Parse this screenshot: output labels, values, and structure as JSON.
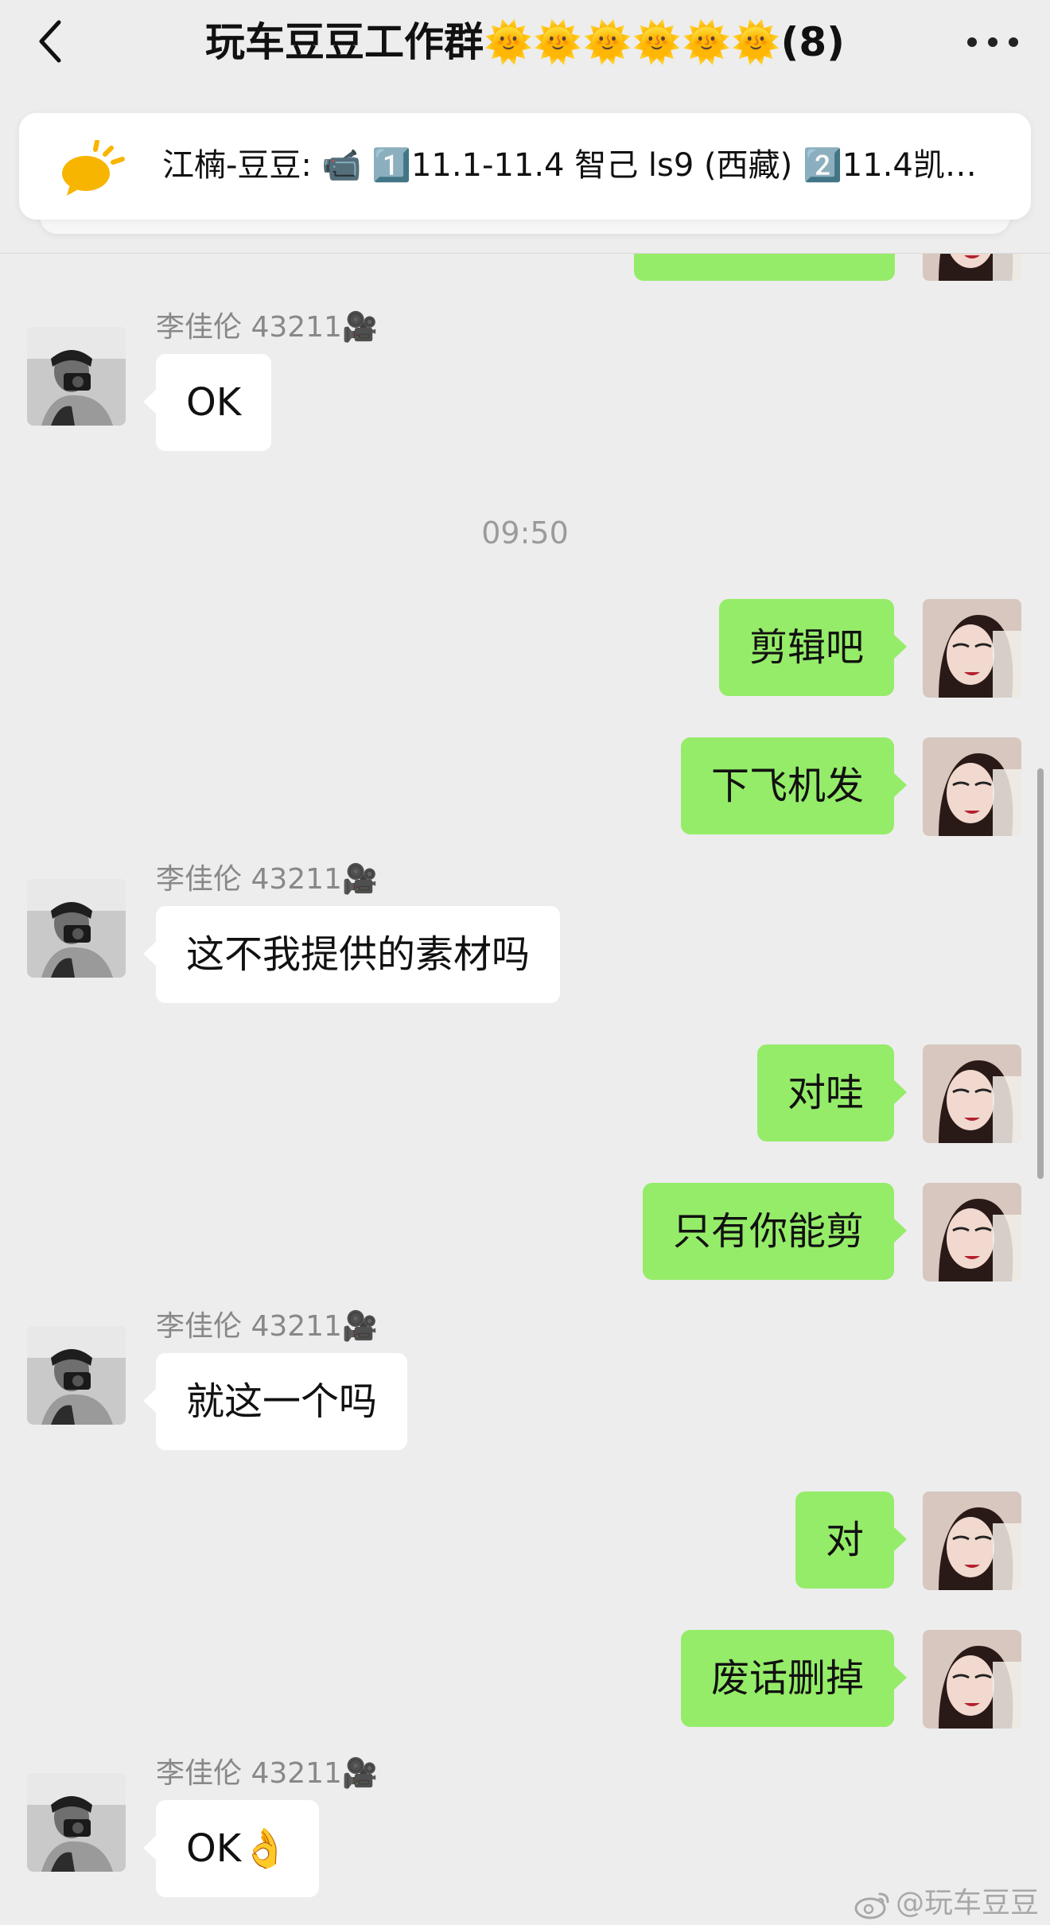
{
  "header": {
    "title": "玩车豆豆工作群🌞🌞🌞🌞🌞🌞(8)",
    "back_icon": "chevron-left-icon",
    "more_icon": "ellipsis-icon"
  },
  "pinned": {
    "icon": "speech-bubble-sun-icon",
    "text": "江楠-豆豆: 📹 1️⃣11.1-11.4 智己 ls9 (西藏) 2️⃣11.4凯迪…"
  },
  "chat": {
    "sender_name": "李佳伦 43211🎥",
    "timestamp": "09:50",
    "messages": [
      {
        "from": "other",
        "text": "OK"
      },
      {
        "from": "me",
        "text": "剪辑吧"
      },
      {
        "from": "me",
        "text": "下飞机发"
      },
      {
        "from": "other",
        "text": "这不我提供的素材吗"
      },
      {
        "from": "me",
        "text": "对哇"
      },
      {
        "from": "me",
        "text": "只有你能剪"
      },
      {
        "from": "other",
        "text": "就这一个吗"
      },
      {
        "from": "me",
        "text": "对"
      },
      {
        "from": "me",
        "text": "废话删掉"
      },
      {
        "from": "other",
        "text": "OK👌"
      }
    ]
  },
  "watermark": {
    "text": "@玩车豆豆",
    "icon": "weibo-logo-icon"
  },
  "colors": {
    "background": "#ededed",
    "my_bubble": "#95ec69",
    "other_bubble": "#ffffff"
  }
}
